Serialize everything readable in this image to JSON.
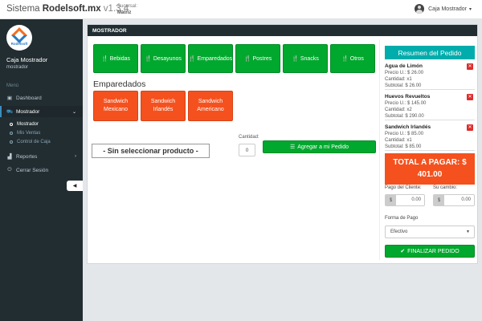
{
  "app": {
    "name_prefix": "Sistema",
    "name": "Rodelsoft.mx",
    "version": "v1.3.4"
  },
  "branch": {
    "label": "Sucursal:",
    "value": "Matriz"
  },
  "user": {
    "name": "Caja Mostrador"
  },
  "sidebar": {
    "logo_text": "Rodelsoft",
    "user_name": "Caja Mostrador",
    "user_role": "mostrador",
    "header": "Menú",
    "items": [
      {
        "label": "Dashboard",
        "icon": "dashboard-icon"
      },
      {
        "label": "Mostrador",
        "icon": "cart-icon"
      },
      {
        "label": "Reportes",
        "icon": "chart-icon"
      },
      {
        "label": "Cerrar Sesión",
        "icon": "power-icon"
      }
    ],
    "subitems": [
      {
        "label": "Mostrador"
      },
      {
        "label": "Mis Ventas"
      },
      {
        "label": "Control de Caja"
      }
    ]
  },
  "panel": {
    "title": "MOSTRADOR"
  },
  "categories": [
    {
      "label": "Bebidas"
    },
    {
      "label": "Desayunos"
    },
    {
      "label": "Emparedados"
    },
    {
      "label": "Postres"
    },
    {
      "label": "Snacks"
    },
    {
      "label": "Otros"
    }
  ],
  "section": {
    "title": "Emparedados"
  },
  "products": [
    {
      "line1": "Sandwich",
      "line2": "Mexicano"
    },
    {
      "line1": "Sandwich",
      "line2": "Irlandés"
    },
    {
      "line1": "Sandwich",
      "line2": "Americano"
    }
  ],
  "selection": {
    "placeholder": "- Sin seleccionar producto -",
    "qty_label": "Cantidad:",
    "qty_value": "0",
    "add_label": "Agregar a mi Pedido"
  },
  "summary": {
    "title": "Resumen del Pedido",
    "items": [
      {
        "name": "Agua de Limón",
        "price": "Precio U.: $ 26.00",
        "qty": "Cantidad: x1",
        "subtotal": "Subtotal: $ 26.00"
      },
      {
        "name": "Huevos Revueltos",
        "price": "Precio U.: $ 145.00",
        "qty": "Cantidad: x2",
        "subtotal": "Subtotal: $ 290.00"
      },
      {
        "name": "Sandwich Irlandés",
        "price": "Precio U.: $ 85.00",
        "qty": "Cantidad: x1",
        "subtotal": "Subtotal: $ 85.00"
      }
    ],
    "total_label": "TOTAL A PAGAR: $",
    "total_value": "401.00",
    "payment_label": "Pago del Cliente:",
    "payment_value": "0.00",
    "change_label": "Su cambio:",
    "change_value": "0.00",
    "currency": "$",
    "method_label": "Forma de Pago",
    "method_value": "Efectivo",
    "finish_label": "FINALIZAR PEDIDO"
  },
  "colors": {
    "green": "#00a82d",
    "orange": "#f4511e",
    "teal": "#00acac",
    "sidebar": "#222d32",
    "red": "#dd2c2c"
  }
}
